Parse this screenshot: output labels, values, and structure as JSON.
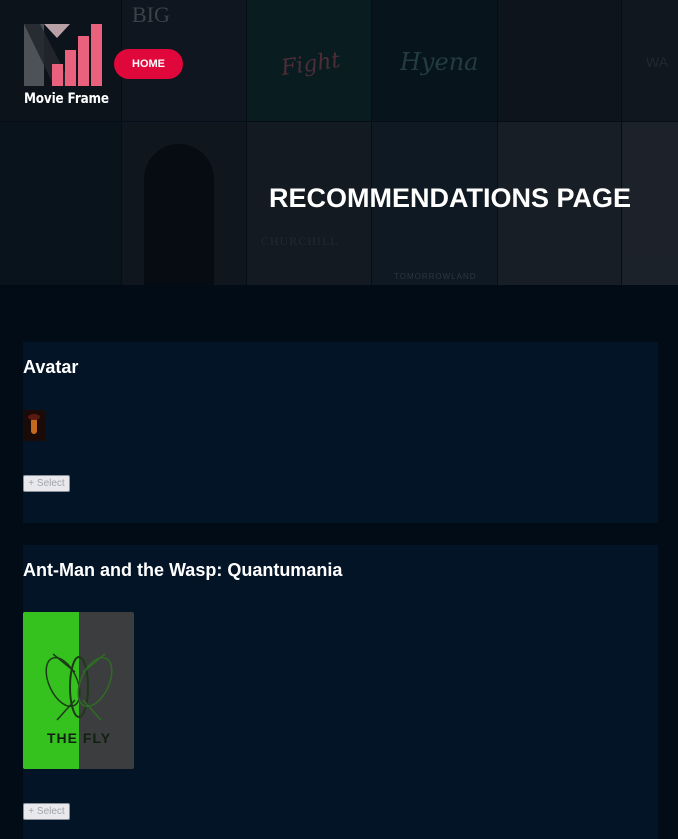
{
  "header": {
    "logo_text": "Movie Frame",
    "home_label": "HOME",
    "page_title": "RECOMMENDATIONS PAGE"
  },
  "hero_posters": [
    {
      "text": "BIG"
    },
    {
      "text": "Fight"
    },
    {
      "text": "Hyena"
    },
    {
      "text": ""
    },
    {
      "text": "WA"
    },
    {
      "text": ""
    },
    {
      "text": ""
    },
    {
      "text": "CHURCHILL"
    },
    {
      "text": "TOMORROWLAND"
    },
    {
      "text": ""
    },
    {
      "text": ""
    }
  ],
  "recommendations": [
    {
      "title": "Avatar",
      "select_label": "+ Select",
      "poster_text": ""
    },
    {
      "title": "Ant-Man and the Wasp: Quantumania",
      "select_label": "+ Select",
      "poster_text": "THE FLY"
    }
  ],
  "colors": {
    "accent": "#e0083b",
    "background": "#020c16",
    "card": "#031427",
    "logo_pink": "#e9617c"
  }
}
